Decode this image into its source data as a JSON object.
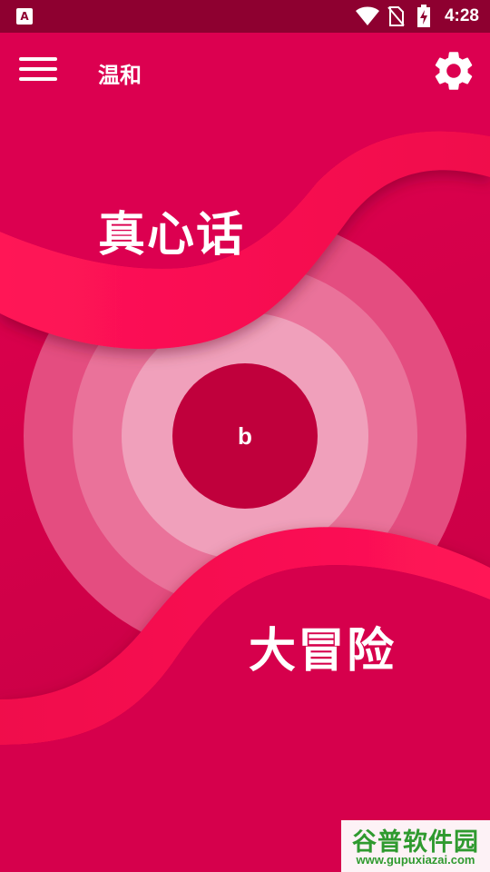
{
  "status_bar": {
    "notification_icon": "A",
    "icons": [
      "wifi-icon",
      "no-sim-icon",
      "battery-charging-icon"
    ],
    "time": "4:28"
  },
  "toolbar": {
    "menu_icon": "hamburger-menu-icon",
    "title": "温和",
    "settings_icon": "gear-icon"
  },
  "main": {
    "truth_label": "真心话",
    "dare_label": "大冒险",
    "center_button_label": "b"
  },
  "watermark": {
    "title": "谷普软件园",
    "url": "www.gupuxiazai.com"
  },
  "colors": {
    "background": "#d4004a",
    "status_bar": "#8e0030",
    "wave": "#ff1457",
    "ring_outer": "#e65a8a",
    "ring_middle": "#ec7fa3",
    "ring_inner": "#f0a3bd",
    "center_button": "#c0003c",
    "watermark_text": "#2f9a2f"
  }
}
